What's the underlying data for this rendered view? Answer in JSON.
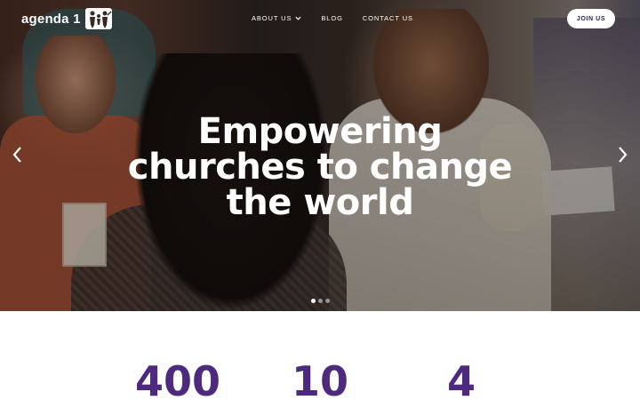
{
  "brand": {
    "name": "agenda 1"
  },
  "nav": {
    "items": [
      {
        "label": "ABOUT US",
        "has_dropdown": true
      },
      {
        "label": "BLOG",
        "has_dropdown": false
      },
      {
        "label": "CONTACT US",
        "has_dropdown": false
      }
    ],
    "join_label": "JOIN US"
  },
  "hero": {
    "headline_lines": [
      "Empowering",
      "churches to change",
      "the world"
    ],
    "slide_count": 3,
    "active_slide": 1
  },
  "stats": {
    "values": [
      "400",
      "10",
      "4"
    ]
  },
  "colors": {
    "accent": "#4e2a7e",
    "text_light": "#ffffff"
  },
  "icons": {
    "logo": "family-figures-icon",
    "prev": "chevron-left-icon",
    "next": "chevron-right-icon",
    "dropdown": "chevron-down-icon"
  }
}
